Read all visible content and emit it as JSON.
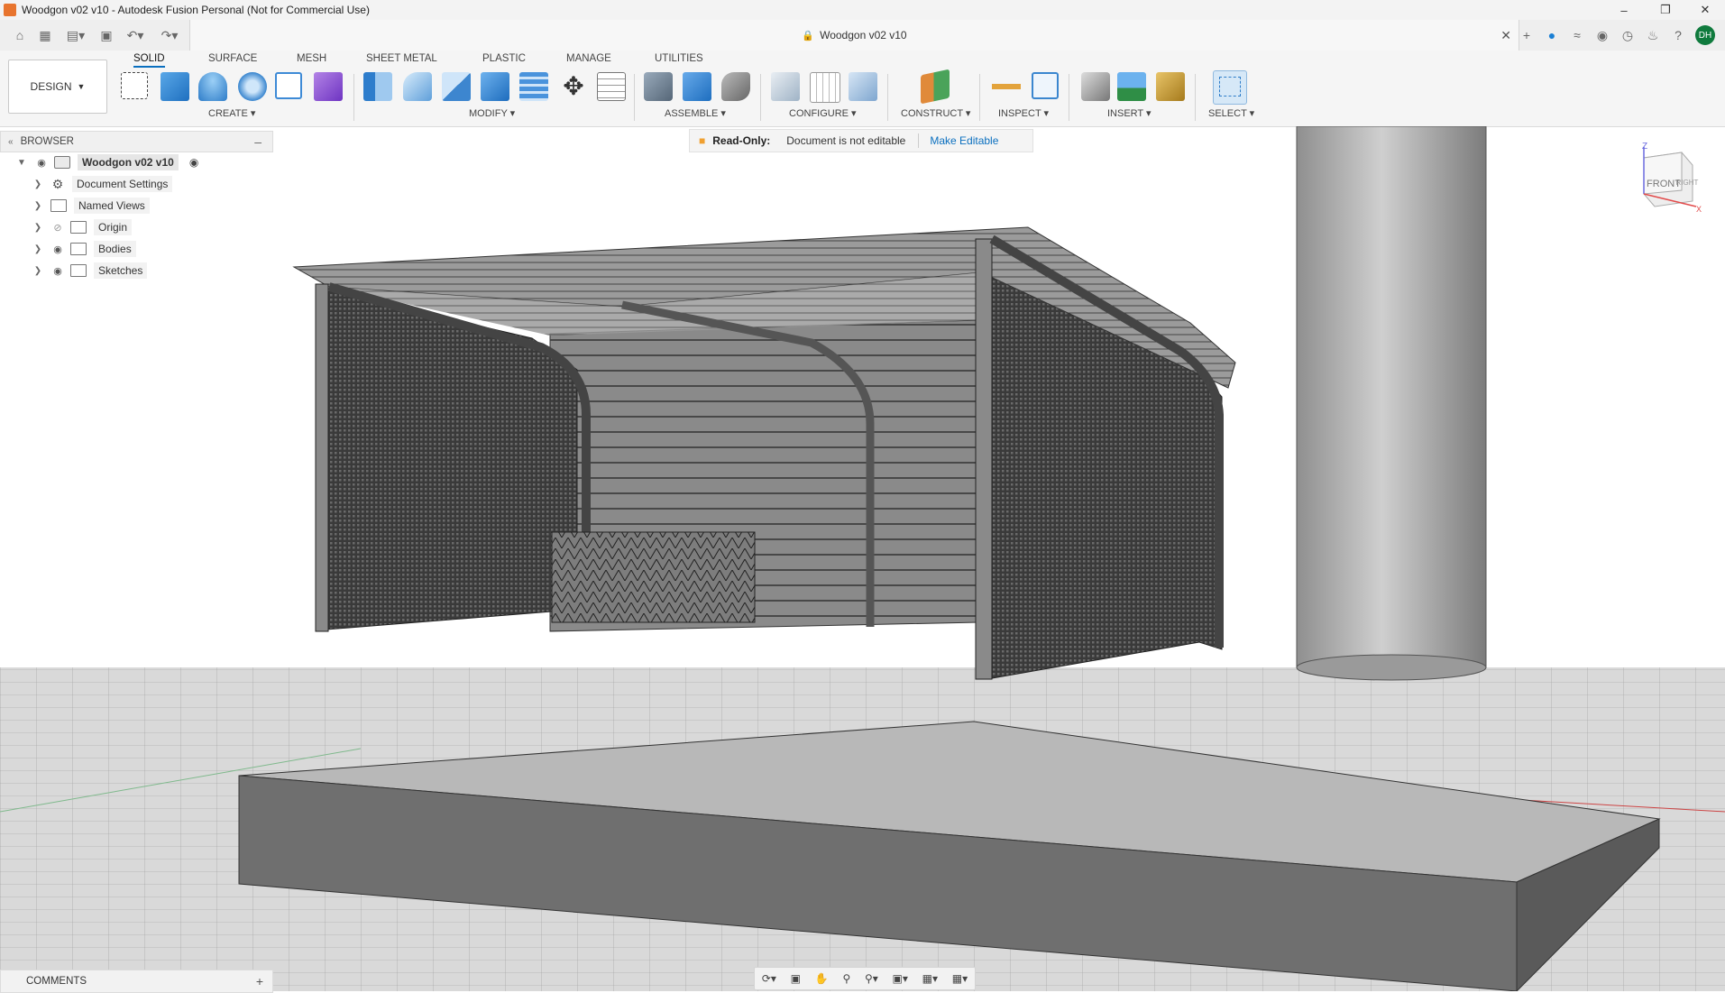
{
  "window": {
    "title": "Woodgon v02 v10 - Autodesk Fusion Personal (Not for Commercial Use)",
    "controls": [
      "minimize-icon",
      "restore-icon",
      "close-icon"
    ]
  },
  "quick_access": {
    "doc_tab_title": "Woodgon v02 v10",
    "user_initials": "DH",
    "icons": [
      "home-icon",
      "grid-icon",
      "file-icon",
      "save-icon",
      "undo-icon",
      "redo-icon"
    ],
    "right_icons": [
      "plus-icon",
      "job-status-icon",
      "offline-icon",
      "extensions-icon",
      "history-icon",
      "bell-icon",
      "help-icon"
    ]
  },
  "ribbon": {
    "workspace": "DESIGN",
    "tabs": [
      "SOLID",
      "SURFACE",
      "MESH",
      "SHEET METAL",
      "PLASTIC",
      "MANAGE",
      "UTILITIES"
    ],
    "active_tab": "SOLID",
    "groups": {
      "create": "CREATE",
      "modify": "MODIFY",
      "assemble": "ASSEMBLE",
      "configure": "CONFIGURE",
      "construct": "CONSTRUCT",
      "inspect": "INSPECT",
      "insert": "INSERT",
      "select": "SELECT"
    }
  },
  "browser": {
    "header": "BROWSER",
    "root": "Woodgon v02 v10",
    "items": [
      "Document Settings",
      "Named Views",
      "Origin",
      "Bodies",
      "Sketches"
    ]
  },
  "notice": {
    "label": "Read-Only:",
    "message": "Document is not editable",
    "action": "Make Editable"
  },
  "viewcube": {
    "front": "FRONT",
    "right": "RIGHT",
    "axis_z": "Z",
    "axis_x": "X"
  },
  "comments": {
    "label": "COMMENTS"
  },
  "colors": {
    "accent": "#0a6fbf",
    "avatar": "#0f7a3d",
    "lock": "#f0a030"
  }
}
